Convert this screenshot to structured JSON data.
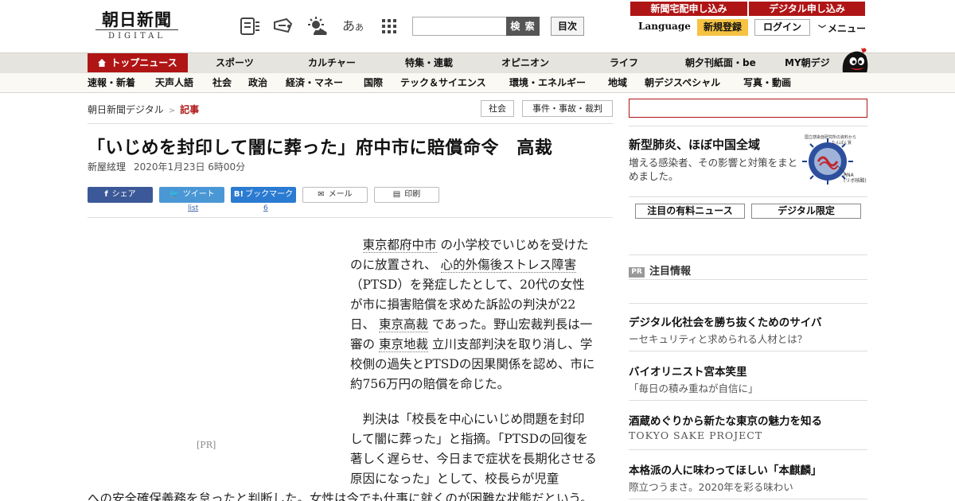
{
  "header": {
    "logo_main": "朝日新聞",
    "logo_sub": "DIGITAL",
    "font_icon_big": "あ",
    "font_icon_small": "あ",
    "search_placeholder": "",
    "search_button": "検 索",
    "index_button": "目次",
    "language": "Language",
    "signup": "新規登録",
    "login": "ログイン",
    "menu": "メニュー",
    "icons": [
      "paper-list-icon",
      "megaphone-icon",
      "weather-icon",
      "font-size-icon",
      "apps-grid-icon"
    ]
  },
  "nav_primary": [
    "トップニュース",
    "スポーツ",
    "カルチャー",
    "特集・連載",
    "オピニオン",
    "ライフ",
    "朝夕刊紙面・be",
    "MY朝デジ"
  ],
  "nav_secondary": [
    "速報・新着",
    "天声人語",
    "社会",
    "政治",
    "経済・マネー",
    "国際",
    "テック＆サイエンス",
    "環境・エネルギー",
    "地域",
    "朝デジスペシャル",
    "写真・動画"
  ],
  "breadcrumb": {
    "home": "朝日新聞デジタル",
    "sep": ">",
    "current": "記事"
  },
  "tags": [
    "社会",
    "事件・事故・裁判"
  ],
  "article": {
    "headline": "「いじめを封印して闇に葬った」府中市に賠償命令　高裁",
    "author": "新屋絃理",
    "date": "2020年1月23日 6時00分",
    "p1": [
      {
        "t": "東京都府中市",
        "link": true
      },
      {
        "t": " の小学校でいじめを受けたのに放置され、 ",
        "link": false
      },
      {
        "t": "心的外傷後ストレス障害",
        "link": true
      },
      {
        "t": " （PTSD）を発症したとして、20代の女性が市に損害賠償を求めた訴訟の判決が22日、 ",
        "link": false
      },
      {
        "t": "東京高裁",
        "link": true
      },
      {
        "t": " であった。野山宏裁判長は一審の ",
        "link": false
      },
      {
        "t": "東京地裁",
        "link": true
      },
      {
        "t": " 立川支部判決を取り消し、学校側の過失とPTSDの因果関係を認め、市に約756万円の賠償を命じた。",
        "link": false
      }
    ],
    "p2": "判決は「校長を中心にいじめ問題を封印して闇に葬った」と指摘。「PTSDの回復を著しく遅らせ、今日まで症状を長期化させる原因になった」として、校長らが児童",
    "p2_wide": "への安全確保義務を怠ったと判断した。女性は今でも仕事に就くのが困難な状態だという。",
    "pr_label": "[PR]"
  },
  "share": {
    "facebook": "シェア",
    "twitter": "ツイート",
    "hatena": "ブックマーク",
    "mail": "メール",
    "print": "印刷",
    "twitter_count": "list",
    "hatena_count": "6"
  },
  "sidebar": {
    "subscribe_paper": "新聞宅配申し込み",
    "subscribe_digital": "デジタル申し込み",
    "promo_title": "新型肺炎、ほぼ中国全域",
    "promo_desc": "増える感染者、その影響と対策をまとめました。",
    "promo_caption": "国立感染症研究所の資料から",
    "promo_caption2": "たんぱく質",
    "promo_rna": "RNA\n(リボ核酸)",
    "tab_paid": "注目の有料ニュース",
    "tab_digital": "デジタル限定",
    "pr_badge": "PR",
    "pr_heading": "注目情報",
    "ads": [
      {
        "title": "デジタル化社会を勝ち抜くためのサイバ",
        "sub": "ーセキュリティと求められる人材とは？"
      },
      {
        "title": "バイオリニスト宮本笑里",
        "sub": "「毎日の積み重ねが自信に」"
      },
      {
        "title": "酒蔵めぐりから新たな東京の魅力を知る",
        "sub": "TOKYO SAKE PROJECT"
      },
      {
        "title": "本格派の人に味わってほしい「本麒麟」",
        "sub": "際立つうまさ。2020年を彩る味わい"
      }
    ]
  },
  "colors": {
    "brand_red": "#b01515",
    "signup_yellow": "#f5c242",
    "facebook": "#3b5998",
    "twitter": "#4a97d6",
    "hatena": "#2a7bd1"
  }
}
